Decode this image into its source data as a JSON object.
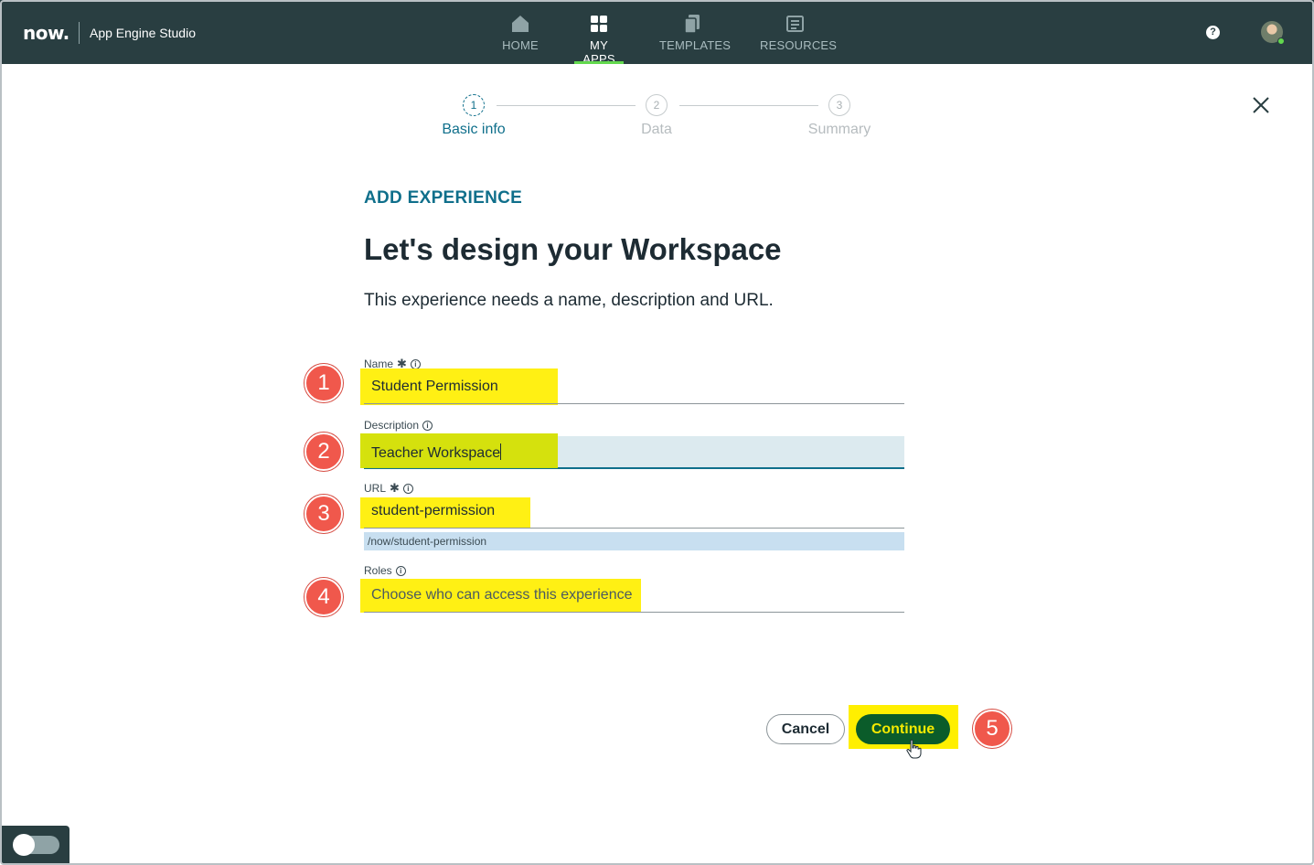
{
  "header": {
    "logo": "now.",
    "app_title": "App Engine Studio",
    "nav": [
      {
        "label": "HOME",
        "icon": "home-icon",
        "active": false
      },
      {
        "label": "MY APPS",
        "icon": "apps-grid-icon",
        "active": true
      },
      {
        "label": "TEMPLATES",
        "icon": "templates-icon",
        "active": false
      },
      {
        "label": "RESOURCES",
        "icon": "resources-icon",
        "active": false
      }
    ],
    "help_icon": "?",
    "user_status": "online"
  },
  "stepper": {
    "steps": [
      {
        "number": "1",
        "label": "Basic info",
        "active": true
      },
      {
        "number": "2",
        "label": "Data",
        "active": false
      },
      {
        "number": "3",
        "label": "Summary",
        "active": false
      }
    ]
  },
  "form": {
    "eyebrow": "ADD EXPERIENCE",
    "title": "Let's design your Workspace",
    "subtitle": "This experience needs a name, description and URL.",
    "fields": {
      "name": {
        "label": "Name",
        "required": true,
        "value": "Student Permission"
      },
      "description": {
        "label": "Description",
        "required": false,
        "value": "Teacher Workspace"
      },
      "url": {
        "label": "URL",
        "required": true,
        "value": "student-permission",
        "hint": "/now/student-permission"
      },
      "roles": {
        "label": "Roles",
        "required": false,
        "placeholder": "Choose who can access this experience"
      }
    },
    "cancel_label": "Cancel",
    "continue_label": "Continue"
  },
  "annotations": [
    "1",
    "2",
    "3",
    "4",
    "5"
  ],
  "colors": {
    "topbar": "#293e41",
    "accent": "#0f6f8b",
    "highlight": "#ffef00",
    "continue_button": "#0b5c2a",
    "badge": "#f0584c"
  }
}
